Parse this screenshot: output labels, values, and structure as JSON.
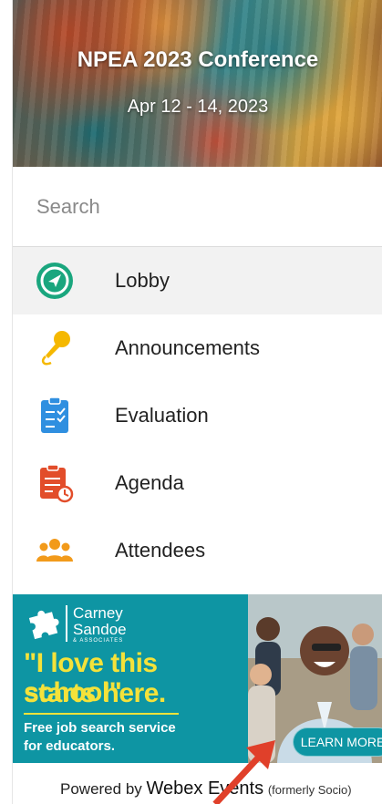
{
  "header": {
    "title": "NPEA 2023 Conference",
    "dates": "Apr 12 - 14, 2023"
  },
  "search": {
    "placeholder": "Search"
  },
  "nav": {
    "items": [
      {
        "label": "Lobby",
        "icon": "compass-icon",
        "active": true
      },
      {
        "label": "Announcements",
        "icon": "microphone-icon",
        "active": false
      },
      {
        "label": "Evaluation",
        "icon": "clipboard-check-icon",
        "active": false
      },
      {
        "label": "Agenda",
        "icon": "agenda-clock-icon",
        "active": false
      },
      {
        "label": "Attendees",
        "icon": "people-icon",
        "active": false
      }
    ]
  },
  "ad": {
    "brand_line1": "Carney",
    "brand_line2": "Sandoe",
    "brand_line3": "& ASSOCIATES",
    "headline_line1": "\"I love this school\"",
    "headline_line2": "starts here.",
    "tagline_line1": "Free job search service",
    "tagline_line2": "for educators.",
    "cta": "LEARN MORE"
  },
  "footer": {
    "powered_by": "Powered by",
    "brand": "Webex Events",
    "former": "(formerly Socio)"
  },
  "colors": {
    "lobby_icon": "#1aa67e",
    "announcement_icon": "#f5b800",
    "evaluation_icon": "#2f8fe0",
    "agenda_icon": "#e24d2a",
    "attendees_icon": "#f29a1a",
    "ad_teal": "#0e95a3",
    "ad_yellow": "#f4e23a",
    "arrow": "#e0402a"
  }
}
